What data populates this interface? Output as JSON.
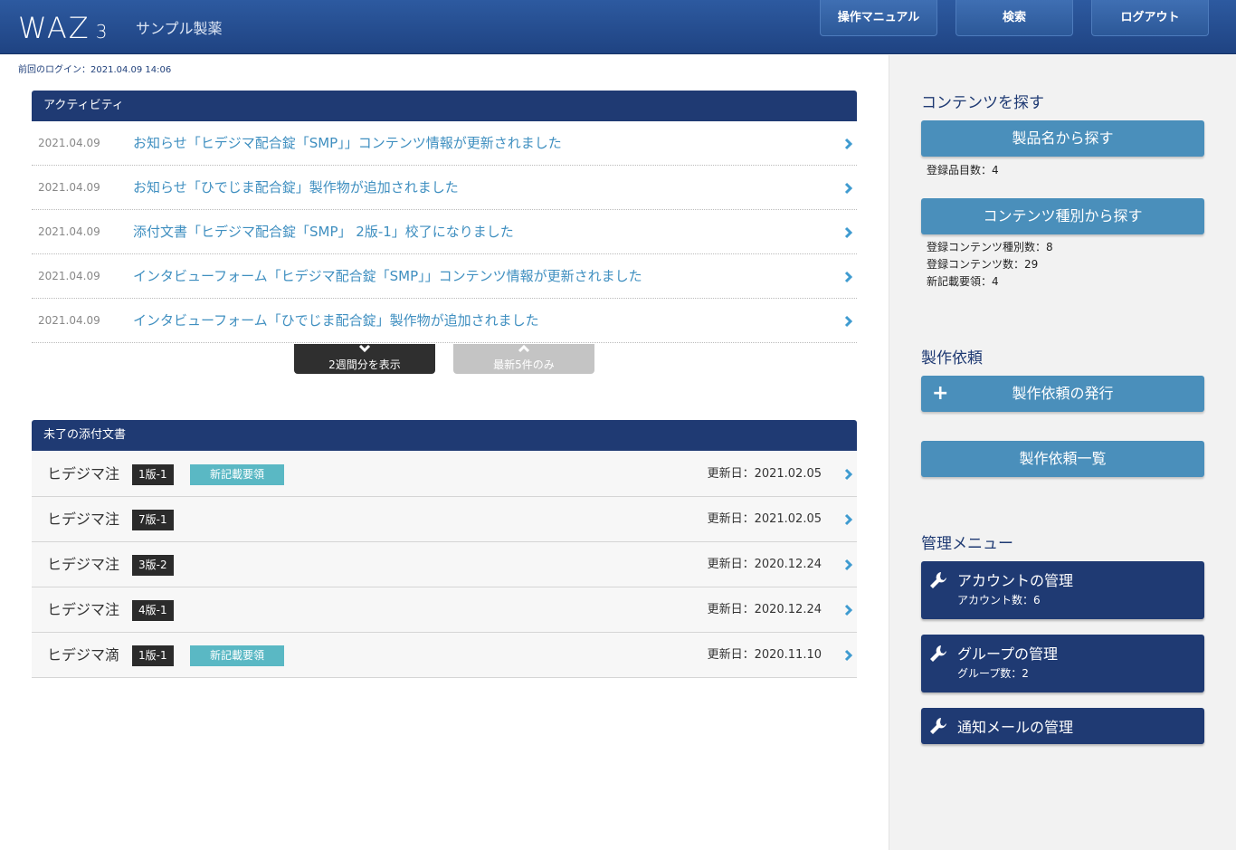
{
  "header": {
    "logo": "WAZ",
    "logo_num": "3",
    "company": "サンプル製薬",
    "buttons": [
      "操作マニュアル",
      "検索",
      "ログアウト"
    ]
  },
  "last_login": "前回のログイン：2021.04.09 14:06",
  "activity": {
    "title": "アクティビティ",
    "items": [
      {
        "date": "2021.04.09",
        "text": "お知らせ「ヒデジマ配合錠「SMP」」コンテンツ情報が更新されました"
      },
      {
        "date": "2021.04.09",
        "text": "お知らせ「ひでじま配合錠」製作物が追加されました"
      },
      {
        "date": "2021.04.09",
        "text": "添付文書「ヒデジマ配合錠「SMP」 2版-1」校了になりました"
      },
      {
        "date": "2021.04.09",
        "text": "インタビューフォーム「ヒデジマ配合錠「SMP」」コンテンツ情報が更新されました"
      },
      {
        "date": "2021.04.09",
        "text": "インタビューフォーム「ひでじま配合錠」製作物が追加されました"
      }
    ],
    "show_2weeks": "2週間分を表示",
    "latest5": "最新5件のみ"
  },
  "pending_docs": {
    "title": "未了の添付文書",
    "items": [
      {
        "name": "ヒデジマ注",
        "version": "1版-1",
        "badge": "新記載要領",
        "updated": "更新日：2021.02.05"
      },
      {
        "name": "ヒデジマ注",
        "version": "7版-1",
        "badge": "",
        "updated": "更新日：2021.02.05"
      },
      {
        "name": "ヒデジマ注",
        "version": "3版-2",
        "badge": "",
        "updated": "更新日：2020.12.24"
      },
      {
        "name": "ヒデジマ注",
        "version": "4版-1",
        "badge": "",
        "updated": "更新日：2020.12.24"
      },
      {
        "name": "ヒデジマ滴",
        "version": "1版-1",
        "badge": "新記載要領",
        "updated": "更新日：2020.11.10"
      }
    ]
  },
  "sidebar": {
    "find_title": "コンテンツを探す",
    "find_by_product": "製品名から探す",
    "product_count": "登録品目数：4",
    "find_by_type": "コンテンツ種別から探す",
    "type_count": "登録コンテンツ種別数：8",
    "content_count": "登録コンテンツ数：29",
    "new_format_count": "新記載要領：4",
    "request_title": "製作依頼",
    "request_new": "製作依頼の発行",
    "request_list": "製作依頼一覧",
    "admin_title": "管理メニュー",
    "admin": [
      {
        "label": "アカウントの管理",
        "sub": "アカウント数：6"
      },
      {
        "label": "グループの管理",
        "sub": "グループ数：2"
      },
      {
        "label": "通知メールの管理",
        "sub": ""
      }
    ]
  },
  "colors": {
    "header": "#2d5aa0",
    "panel": "#1f3a73",
    "accent": "#4a8fbb",
    "link": "#3f8fc0",
    "badge": "#5ab8c4"
  }
}
